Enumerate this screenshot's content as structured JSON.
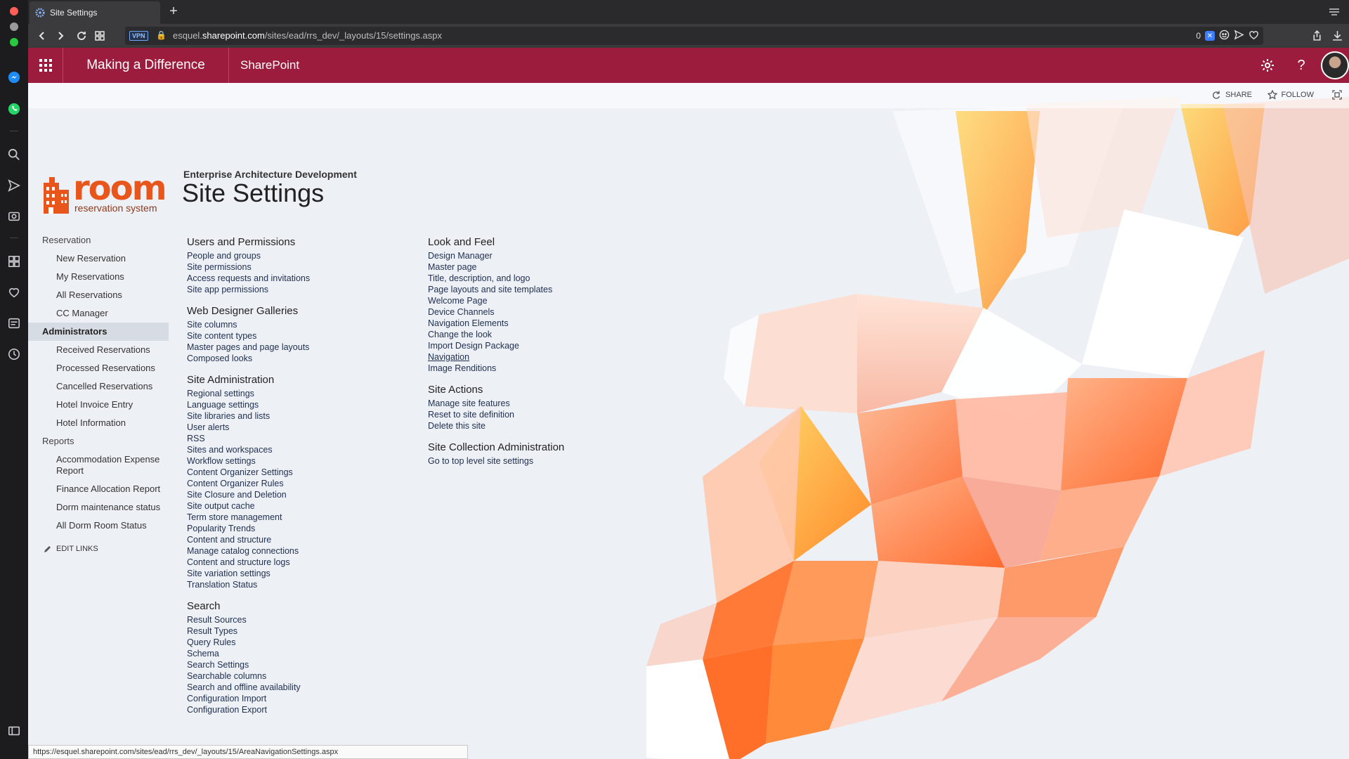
{
  "browser": {
    "tab_title": "Site Settings",
    "new_tab_symbol": "+",
    "vpn_label": "VPN",
    "url_host": "esquel.sharepoint.com",
    "url_prefix": "esquel.",
    "url_domain": "sharepoint.com",
    "url_path": "/sites/ead/rrs_dev/_layouts/15/settings.aspx",
    "tracker_count": "0",
    "status_url": "https://esquel.sharepoint.com/sites/ead/rrs_dev/_layouts/15/AreaNavigationSettings.aspx"
  },
  "suitebar": {
    "brand": "Making a Difference",
    "product": "SharePoint",
    "color": "#9b1c3c"
  },
  "ribbon": {
    "share_label": "SHARE",
    "follow_label": "FOLLOW"
  },
  "logo": {
    "word": "room",
    "subtitle": "reservation system"
  },
  "header": {
    "site_name": "Enterprise Architecture Development",
    "page_title": "Site Settings"
  },
  "quicklaunch": {
    "reservation": {
      "label": "Reservation",
      "items": [
        "New Reservation",
        "My Reservations",
        "All Reservations",
        "CC Manager"
      ]
    },
    "administrators": {
      "label": "Administrators",
      "items": [
        "Received Reservations",
        "Processed Reservations",
        "Cancelled Reservations",
        "Hotel Invoice Entry",
        "Hotel Information"
      ]
    },
    "reports": {
      "label": "Reports",
      "items": [
        "Accommodation Expense Report",
        "Finance Allocation Report",
        "Dorm maintenance status",
        "All Dorm Room Status"
      ]
    },
    "edit_links": "EDIT LINKS"
  },
  "settings": {
    "users_permissions": {
      "title": "Users and Permissions",
      "links": [
        "People and groups",
        "Site permissions",
        "Access requests and invitations",
        "Site app permissions"
      ]
    },
    "web_designer": {
      "title": "Web Designer Galleries",
      "links": [
        "Site columns",
        "Site content types",
        "Master pages and page layouts",
        "Composed looks"
      ]
    },
    "site_admin": {
      "title": "Site Administration",
      "links": [
        "Regional settings",
        "Language settings",
        "Site libraries and lists",
        "User alerts",
        "RSS",
        "Sites and workspaces",
        "Workflow settings",
        "Content Organizer Settings",
        "Content Organizer Rules",
        "Site Closure and Deletion",
        "Site output cache",
        "Term store management",
        "Popularity Trends",
        "Content and structure",
        "Manage catalog connections",
        "Content and structure logs",
        "Site variation settings",
        "Translation Status"
      ]
    },
    "search": {
      "title": "Search",
      "links": [
        "Result Sources",
        "Result Types",
        "Query Rules",
        "Schema",
        "Search Settings",
        "Searchable columns",
        "Search and offline availability",
        "Configuration Import",
        "Configuration Export"
      ]
    },
    "look_feel": {
      "title": "Look and Feel",
      "links": [
        "Design Manager",
        "Master page",
        "Title, description, and logo",
        "Page layouts and site templates",
        "Welcome Page",
        "Device Channels",
        "Navigation Elements",
        "Change the look",
        "Import Design Package",
        "Navigation",
        "Image Renditions"
      ]
    },
    "site_actions": {
      "title": "Site Actions",
      "links": [
        "Manage site features",
        "Reset to site definition",
        "Delete this site"
      ]
    },
    "site_collection": {
      "title": "Site Collection Administration",
      "links": [
        "Go to top level site settings"
      ]
    }
  }
}
